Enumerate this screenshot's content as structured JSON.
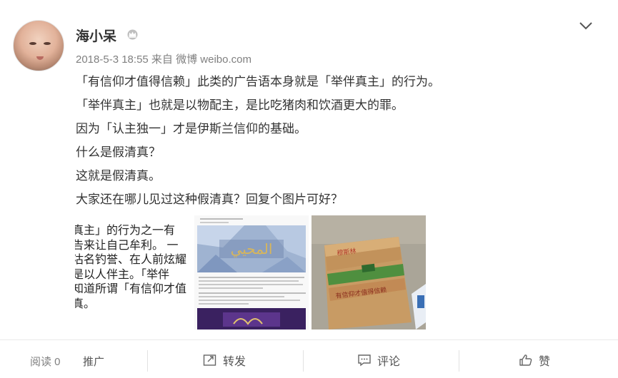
{
  "post": {
    "username": "海小呆",
    "vip_icon": "crown-icon",
    "meta": {
      "time": "2018-5-3 18:55",
      "source_prefix": "来自",
      "source": "微博 weibo.com"
    },
    "lines": [
      "「有信仰才值得信赖」此类的广告语本身就是「举伴真主」的行为。",
      "「举伴真主」也就是以物配主，是比吃猪肉和饮酒更大的罪。",
      "因为「认主独一」才是伊斯兰信仰的基础。",
      "什么是假清真？",
      "这就是假清真。",
      "大家还在哪儿见过这种假清真？回复个图片可好？"
    ]
  },
  "images": {
    "image1_lines": [
      "真主」的行为之一有",
      "告来让自己牟利。 一",
      "沽名钓誉、在人前炫耀",
      "是以人伴主。「举伴",
      "知道所谓「有信仰才值",
      "真。"
    ],
    "image2_banner_text": "المحيي",
    "image3_label_top": "穆斯林",
    "image3_label_bottom": "有信仰才值得信赖"
  },
  "footer": {
    "read_label": "阅读 0",
    "promo_label": "推广",
    "repost_label": "转发",
    "comment_label": "评论",
    "like_label": "赞"
  },
  "colors": {
    "text": "#333333",
    "muted": "#808080",
    "divider": "#e9e9e9"
  }
}
